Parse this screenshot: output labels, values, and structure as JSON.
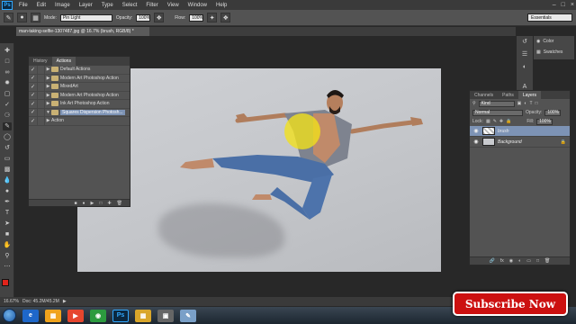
{
  "app": {
    "logo": "Ps"
  },
  "menu": [
    "File",
    "Edit",
    "Image",
    "Layer",
    "Type",
    "Select",
    "Filter",
    "View",
    "Window",
    "Help"
  ],
  "options_bar": {
    "mode_label": "Mode:",
    "mode_value": "Pin Light",
    "opacity_label": "Opacity:",
    "opacity_value": "100%",
    "flow_label": "Flow:",
    "flow_value": "100%",
    "workspace": "Essentials"
  },
  "document_tab": {
    "title": "man-taking-selfie-1307487.jpg @ 16.7% (brush, RGB/8) *"
  },
  "actions_panel": {
    "tabs": [
      "History",
      "Actions"
    ],
    "items": [
      {
        "label": "Default Actions",
        "type": "set"
      },
      {
        "label": "Modern Art Photoshop Action",
        "type": "set"
      },
      {
        "label": "MixedArt",
        "type": "set"
      },
      {
        "label": "Modern Art Photoshop Action",
        "type": "set"
      },
      {
        "label": "Ink Art Photoshop Action",
        "type": "set"
      },
      {
        "label": "Squares Dispersion Photosh...",
        "type": "set",
        "selected": true,
        "expanded": true
      },
      {
        "label": "Action",
        "type": "action"
      }
    ]
  },
  "mini_panel": {
    "color_label": "Color",
    "swatches_label": "Swatches"
  },
  "layers_panel": {
    "tabs": [
      "Channels",
      "Paths",
      "Layers"
    ],
    "kind": "Kind",
    "blend_mode": "Normal",
    "opacity_label": "Opacity:",
    "opacity_value": "100%",
    "lock_label": "Lock:",
    "fill_label": "Fill:",
    "fill_value": "100%",
    "layers": [
      {
        "name": "brush",
        "selected": true
      },
      {
        "name": "Background",
        "selected": false
      }
    ]
  },
  "status_bar": {
    "zoom": "16.67%",
    "doc": "Doc: 45.2M/45.2M"
  },
  "overlay": {
    "subscribe": "Subscribe Now"
  },
  "colors": {
    "foreground": "#e0241b",
    "background": "#ffffff",
    "brush_highlight": "#f2e21a"
  }
}
